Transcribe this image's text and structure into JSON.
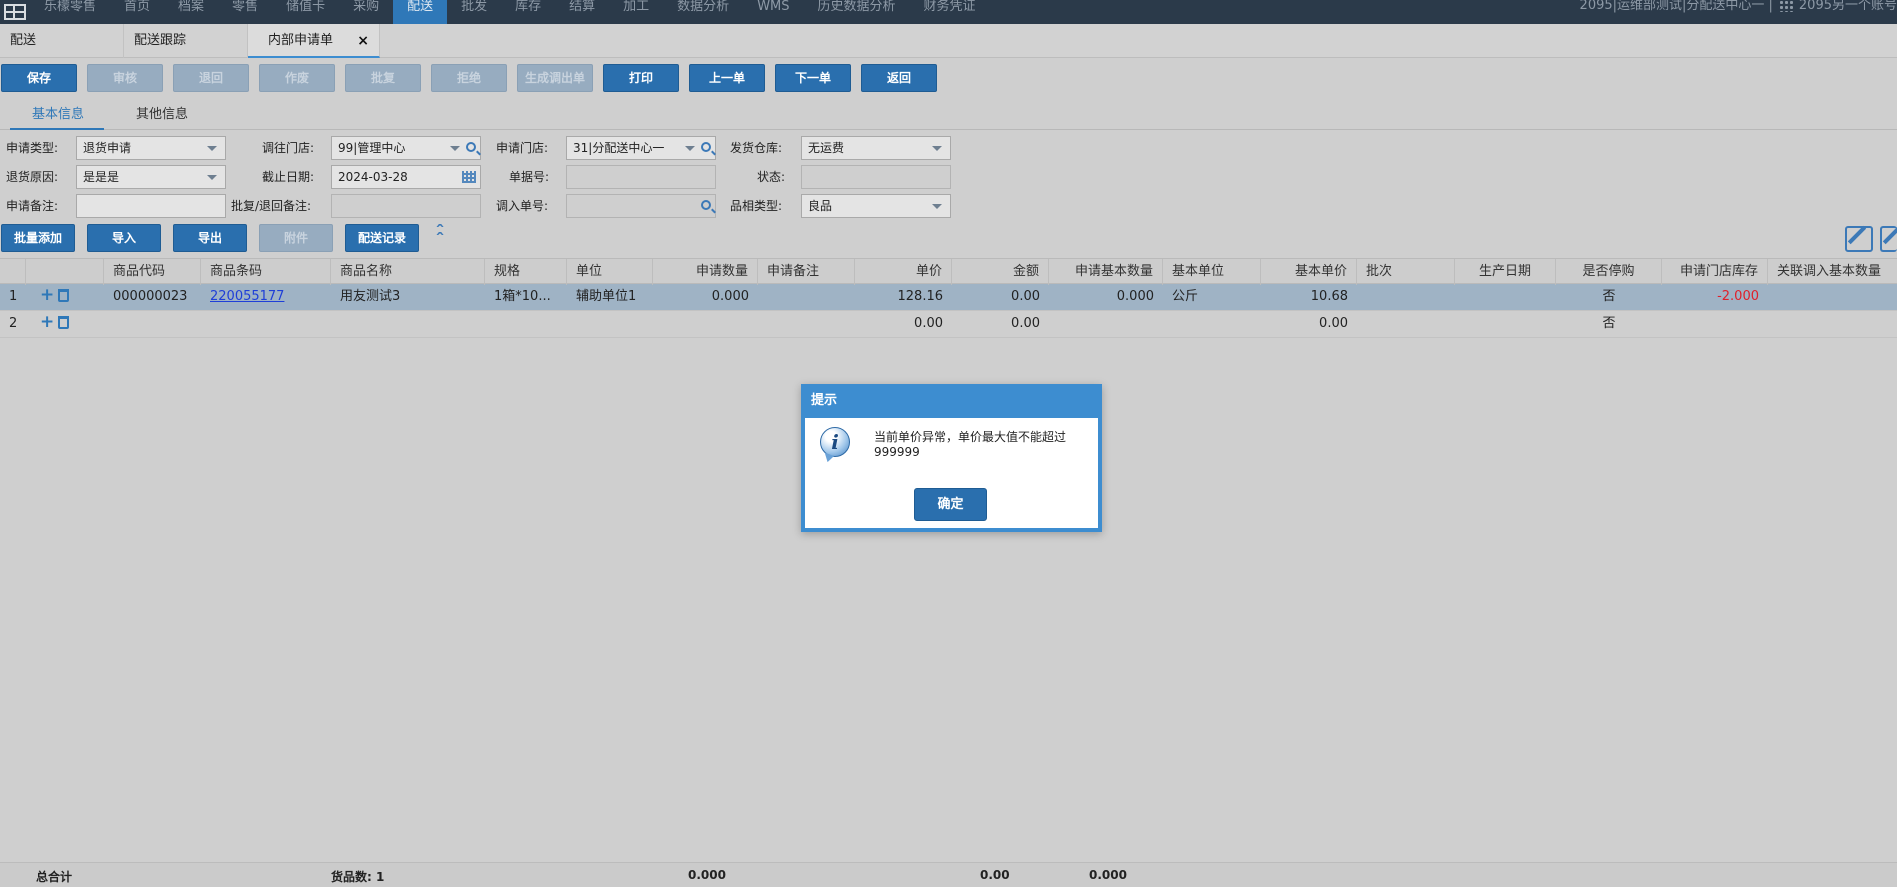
{
  "topnav": {
    "items": [
      {
        "label": "乐檬零售",
        "active": false
      },
      {
        "label": "首页",
        "active": false
      },
      {
        "label": "档案",
        "active": false
      },
      {
        "label": "零售",
        "active": false
      },
      {
        "label": "储值卡",
        "active": false
      },
      {
        "label": "采购",
        "active": false
      },
      {
        "label": "配送",
        "active": true
      },
      {
        "label": "批发",
        "active": false
      },
      {
        "label": "库存",
        "active": false
      },
      {
        "label": "结算",
        "active": false
      },
      {
        "label": "加工",
        "active": false
      },
      {
        "label": "数据分析",
        "active": false
      },
      {
        "label": "WMS",
        "active": false
      },
      {
        "label": "历史数据分析",
        "active": false
      },
      {
        "label": "财务凭证",
        "active": false
      }
    ],
    "account": "2095|运维部测试|分配送中心一 |",
    "account2": "2095另一个账号"
  },
  "tabs": [
    {
      "label": "配送",
      "active": false
    },
    {
      "label": "配送跟踪",
      "active": false
    },
    {
      "label": "内部申请单",
      "active": true,
      "close": "×"
    }
  ],
  "toolbar": [
    {
      "label": "保存",
      "disabled": false
    },
    {
      "label": "审核",
      "disabled": true
    },
    {
      "label": "退回",
      "disabled": true
    },
    {
      "label": "作废",
      "disabled": true
    },
    {
      "label": "批复",
      "disabled": true
    },
    {
      "label": "拒绝",
      "disabled": true
    },
    {
      "label": "生成调出单",
      "disabled": true
    },
    {
      "label": "打印",
      "disabled": false
    },
    {
      "label": "上一单",
      "disabled": false
    },
    {
      "label": "下一单",
      "disabled": false
    },
    {
      "label": "返回",
      "disabled": false
    }
  ],
  "subtabs": [
    {
      "label": "基本信息",
      "active": true
    },
    {
      "label": "其他信息",
      "active": false
    }
  ],
  "form": {
    "apply_type_label": "申请类型:",
    "apply_type_value": "退货申请",
    "to_store_label": "调往门店:",
    "to_store_value": "99|管理中心",
    "apply_store_label": "申请门店:",
    "apply_store_value": "31|分配送中心一",
    "ship_wh_label": "发货仓库:",
    "ship_wh_value": "无运费",
    "return_reason_label": "退货原因:",
    "return_reason_value": "是是是",
    "deadline_label": "截止日期:",
    "deadline_value": "2024-03-28",
    "doc_no_label": "单据号:",
    "doc_no_value": "",
    "status_label": "状态:",
    "status_value": "",
    "apply_remark_label": "申请备注:",
    "apply_remark_value": "",
    "reply_remark_label": "批复/退回备注:",
    "reply_remark_value": "",
    "in_doc_label": "调入单号:",
    "in_doc_value": "",
    "quality_label": "品相类型:",
    "quality_value": "良品"
  },
  "toolbar2": [
    {
      "label": "批量添加",
      "disabled": false
    },
    {
      "label": "导入",
      "disabled": false
    },
    {
      "label": "导出",
      "disabled": false
    },
    {
      "label": "附件",
      "disabled": true
    },
    {
      "label": "配送记录",
      "disabled": false
    }
  ],
  "grid": {
    "columns": [
      "",
      "",
      "商品代码",
      "商品条码",
      "商品名称",
      "规格",
      "单位",
      "申请数量",
      "申请备注",
      "单价",
      "金额",
      "申请基本数量",
      "基本单位",
      "基本单价",
      "批次",
      "生产日期",
      "是否停购",
      "申请门店库存",
      "关联调入基本数量"
    ],
    "rows": [
      {
        "no": "1",
        "code": "000000023",
        "barcode": "220055177",
        "name": "用友测试3",
        "spec": "1箱*10...",
        "unit": "辅助单位1",
        "qty": "0.000",
        "remark": "",
        "price": "128.16",
        "amount": "0.00",
        "base_qty": "0.000",
        "base_unit": "公斤",
        "base_price": "10.68",
        "batch": "",
        "prod_date": "",
        "stop": "否",
        "stock": "-2.000",
        "link_qty": ""
      },
      {
        "no": "2",
        "code": "",
        "barcode": "",
        "name": "",
        "spec": "",
        "unit": "",
        "qty": "",
        "remark": "",
        "price": "0.00",
        "amount": "0.00",
        "base_qty": "",
        "base_unit": "",
        "base_price": "0.00",
        "batch": "",
        "prod_date": "",
        "stop": "否",
        "stock": "",
        "link_qty": ""
      }
    ]
  },
  "footer": {
    "total_label": "总合计",
    "goods_count": "货品数: 1",
    "qty_total": "0.000",
    "amount_total": "0.00",
    "base_qty_total": "0.000"
  },
  "modal": {
    "title": "提示",
    "message": "当前单价异常，单价最大值不能超过999999",
    "ok": "确定"
  },
  "colors": {
    "nav_bg": "#2b3a4a",
    "accent": "#2f78b8",
    "selected_row": "#9fb3c5",
    "negative": "#e0202a"
  }
}
